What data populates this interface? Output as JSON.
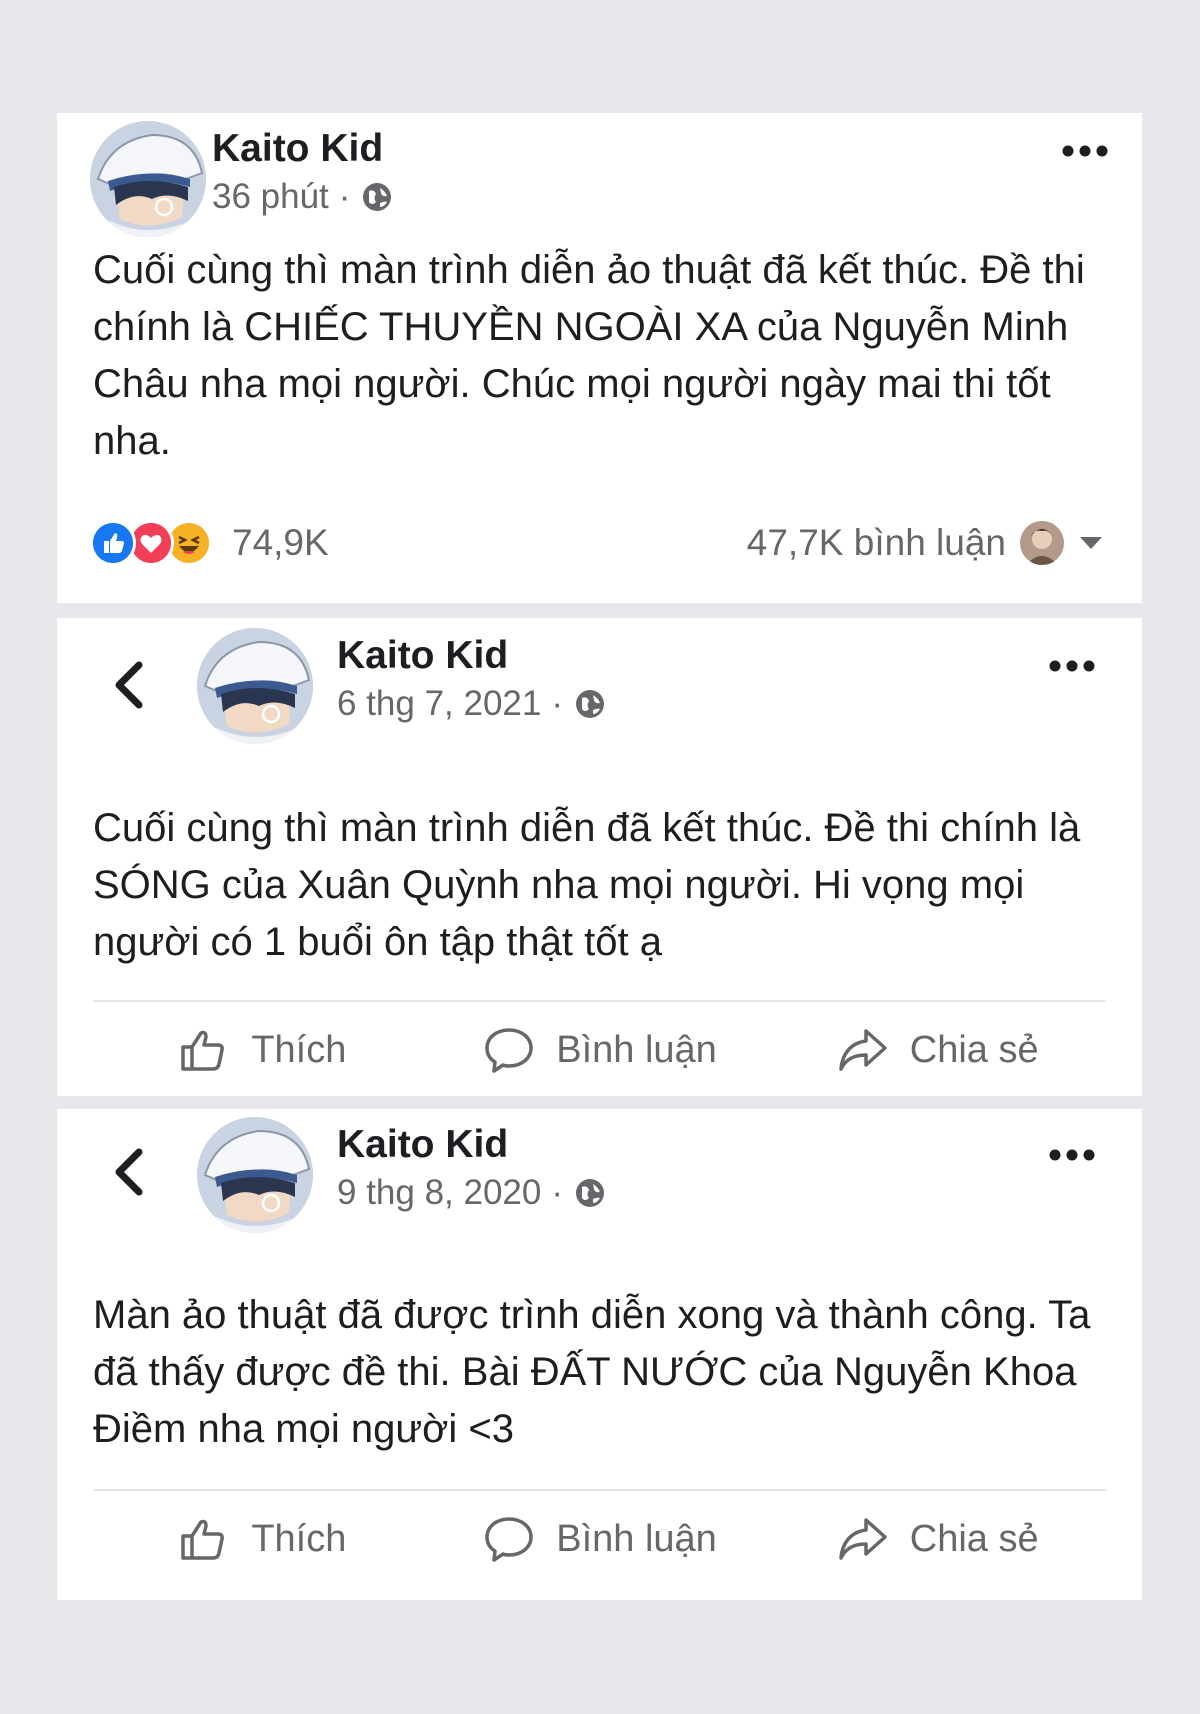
{
  "posts": [
    {
      "author": "Kaito Kid",
      "time": "36 phút",
      "separator": "·",
      "privacy_icon": "globe-icon",
      "text": "Cuối cùng thì màn trình diễn ảo thuật đã kết thúc. Đề thi chính là CHIẾC THUYỀN NGOÀI XA của Nguyễn Minh Châu nha mọi người. Chúc mọi người ngày mai thi tốt nha.",
      "reaction_icons": [
        "like-reaction-icon",
        "love-reaction-icon",
        "haha-reaction-icon"
      ],
      "reaction_count": "74,9K",
      "comment_count": "47,7K bình luận"
    },
    {
      "author": "Kaito Kid",
      "time": "6 thg 7, 2021",
      "separator": "·",
      "privacy_icon": "globe-icon",
      "text": "Cuối cùng thì màn trình diễn đã kết thúc. Đề thi chính là SÓNG của Xuân Quỳnh nha mọi người. Hi vọng mọi người có 1 buổi ôn tập thật tốt ạ"
    },
    {
      "author": "Kaito Kid",
      "time": "9 thg 8, 2020",
      "separator": "·",
      "privacy_icon": "globe-icon",
      "text": "Màn ảo thuật đã được trình diễn xong và thành công. Ta đã thấy được đề thi. Bài ĐẤT NƯỚC của Nguyễn Khoa Điềm nha mọi người <3"
    }
  ],
  "actions": {
    "like": "Thích",
    "comment": "Bình luận",
    "share": "Chia sẻ"
  },
  "colors": {
    "background": "#e7e8ec",
    "card": "#ffffff",
    "text": "#1c1e21",
    "secondary_text": "#65676b",
    "like_blue": "#1877f2",
    "love_red": "#f33e58",
    "haha_yellow": "#f7b125"
  }
}
